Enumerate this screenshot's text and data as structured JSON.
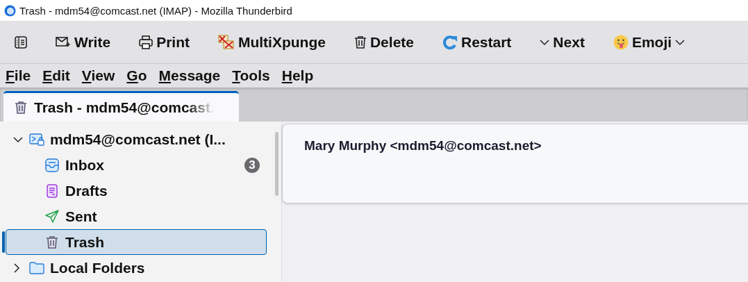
{
  "window": {
    "title": "Trash - mdm54@comcast.net (IMAP) - Mozilla Thunderbird"
  },
  "toolbar": {
    "buttons": [
      {
        "kind": "sidebar"
      },
      {
        "kind": "write",
        "label": "Write"
      },
      {
        "kind": "print",
        "label": "Print"
      },
      {
        "kind": "multixpunge",
        "label": "MultiXpunge"
      },
      {
        "kind": "delete",
        "label": "Delete"
      },
      {
        "kind": "restart",
        "label": "Restart"
      },
      {
        "kind": "next",
        "label": "Next"
      },
      {
        "kind": "emoji",
        "label": "Emoji"
      }
    ]
  },
  "menu_bar": {
    "items": [
      "File",
      "Edit",
      "View",
      "Go",
      "Message",
      "Tools",
      "Help"
    ]
  },
  "tabs": [
    {
      "label": "Trash - mdm54@comcast.",
      "selected": true
    }
  ],
  "folder_tree": [
    {
      "kind": "account",
      "label": "mdm54@comcast.net (I...",
      "expanded": true,
      "selected": false,
      "children": [
        {
          "kind": "inbox",
          "label": "Inbox",
          "badge": "3",
          "selected": false
        },
        {
          "kind": "drafts",
          "label": "Drafts",
          "selected": false
        },
        {
          "kind": "sent",
          "label": "Sent",
          "selected": false
        },
        {
          "kind": "trash",
          "label": "Trash",
          "selected": true
        }
      ]
    },
    {
      "kind": "local",
      "label": "Local Folders",
      "expanded": false,
      "selected": false
    }
  ],
  "message_header": {
    "from": "Mary Murphy <mdm54@comcast.net>"
  }
}
